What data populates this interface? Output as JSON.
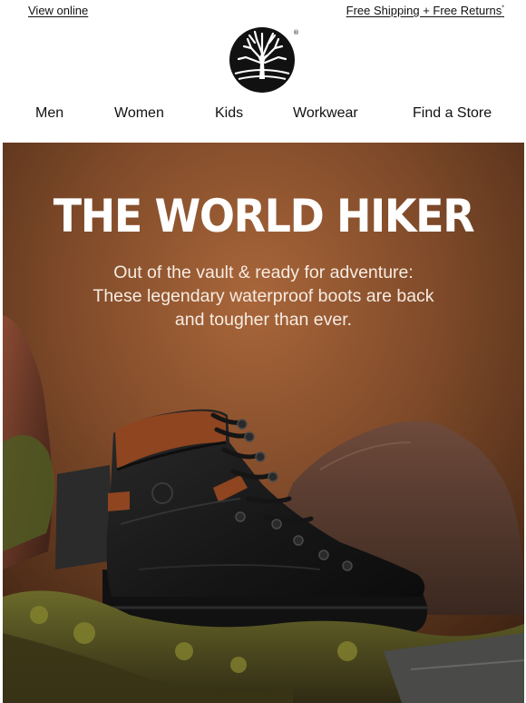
{
  "topbar": {
    "view_online": "View online",
    "shipping": "Free Shipping + Free Returns",
    "shipping_mark": "*"
  },
  "brand": {
    "logo_icon": "tree-logo-icon",
    "registered": "®"
  },
  "nav": {
    "items": [
      "Men",
      "Women",
      "Kids",
      "Workwear",
      "Find a Store"
    ]
  },
  "hero": {
    "title": "THE WORLD HIKER",
    "subtitle_line1": "Out of the vault & ready for adventure:",
    "subtitle_line2": "These legendary waterproof boots are back",
    "subtitle_line3": "and tougher than ever."
  },
  "colors": {
    "backdrop": "#8a5330",
    "backdrop_dark": "#4a2a17",
    "boot": "#1b1b1b",
    "boot_collar": "#8e4520",
    "moss": "#7a7a2a"
  }
}
